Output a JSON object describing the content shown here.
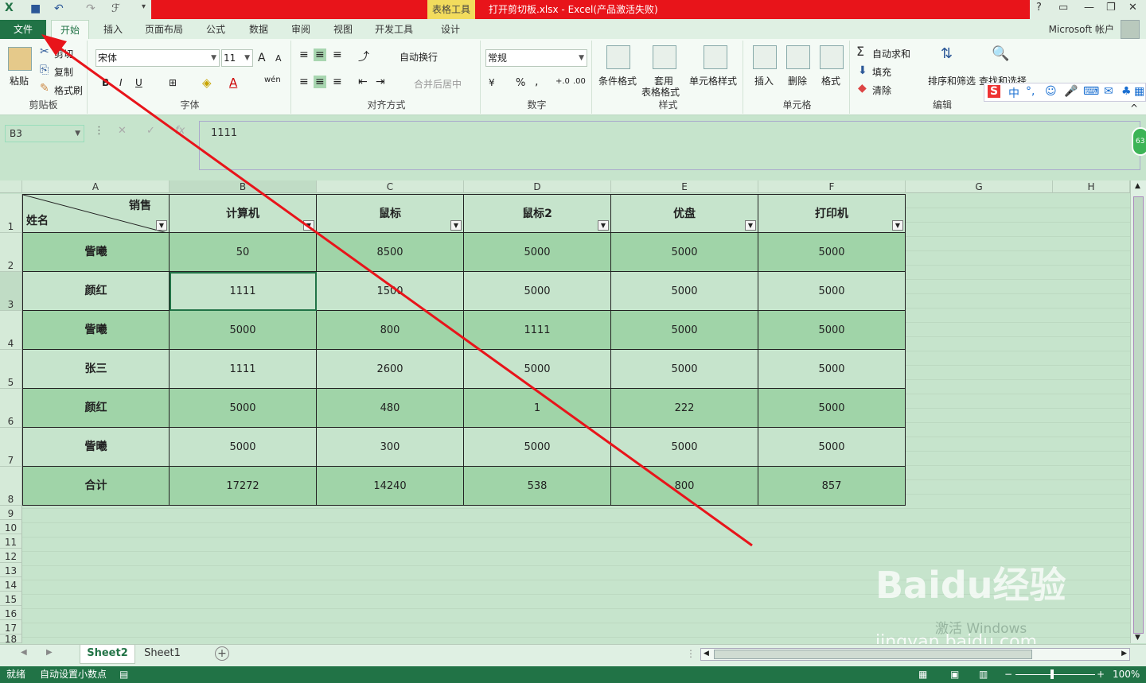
{
  "titlebar": {
    "context_tab": "表格工具",
    "title": "打开剪切板.xlsx -  Excel(产品激活失败)"
  },
  "tabs": [
    "文件",
    "开始",
    "插入",
    "页面布局",
    "公式",
    "数据",
    "审阅",
    "视图",
    "开发工具",
    "设计"
  ],
  "account": "Microsoft 帐户",
  "ribbon": {
    "clipboard": {
      "label": "剪贴板",
      "paste": "粘贴",
      "cut": "剪切",
      "copy": "复制",
      "format_painter": "格式刷"
    },
    "font": {
      "label": "字体",
      "name": "宋体",
      "size": "11"
    },
    "alignment": {
      "label": "对齐方式",
      "wrap": "自动换行",
      "merge": "合并后居中"
    },
    "number": {
      "label": "数字",
      "format": "常规",
      "percent": "%",
      "comma": ","
    },
    "styles": {
      "label": "样式",
      "conditional": "条件格式",
      "table_format_1": "套用",
      "table_format_2": "表格格式",
      "cell_styles": "单元格样式"
    },
    "cells": {
      "label": "单元格",
      "insert": "插入",
      "delete": "删除",
      "format": "格式"
    },
    "editing": {
      "label": "编辑",
      "autosum": "自动求和",
      "fill": "填充",
      "clear": "清除",
      "sort": "排序和筛选",
      "find": "查找和选择"
    }
  },
  "formula": {
    "namebox": "B3",
    "fx": "fx",
    "value": "1111"
  },
  "columns": [
    "A",
    "B",
    "C",
    "D",
    "E",
    "F",
    "G",
    "H"
  ],
  "rows": [
    "1",
    "2",
    "3",
    "4",
    "5",
    "6",
    "7",
    "8",
    "9",
    "10",
    "11",
    "12",
    "13",
    "14",
    "15",
    "16",
    "17",
    "18"
  ],
  "table": {
    "header_corner_top": "销售",
    "header_corner_bottom": "姓名",
    "headers": [
      "计算机",
      "鼠标",
      "鼠标2",
      "优盘",
      "打印机"
    ],
    "data": [
      {
        "name": "訾曦",
        "values": [
          "50",
          "8500",
          "5000",
          "5000",
          "5000"
        ]
      },
      {
        "name": "颜红",
        "values": [
          "1111",
          "1500",
          "5000",
          "5000",
          "5000"
        ]
      },
      {
        "name": "訾曦",
        "values": [
          "5000",
          "800",
          "1111",
          "5000",
          "5000"
        ]
      },
      {
        "name": "张三",
        "values": [
          "1111",
          "2600",
          "5000",
          "5000",
          "5000"
        ]
      },
      {
        "name": "颜红",
        "values": [
          "5000",
          "480",
          "1",
          "222",
          "5000"
        ]
      },
      {
        "name": "訾曦",
        "values": [
          "5000",
          "300",
          "5000",
          "5000",
          "5000"
        ]
      },
      {
        "name": "合计",
        "values": [
          "17272",
          "14240",
          "538",
          "800",
          "857"
        ]
      }
    ]
  },
  "sheets": [
    "Sheet2",
    "Sheet1"
  ],
  "status": {
    "ready": "就绪",
    "autodecimal": "自动设置小数点",
    "zoom": "100%"
  },
  "watermark": {
    "logo": "Baidu经验",
    "url": "jingyan.baidu.com",
    "activate": "激活 Windows"
  },
  "ime": {
    "lang": "中"
  },
  "colors": {
    "excel_green": "#217346",
    "row_dark": "#a0d4a8",
    "row_light": "#c6e4cc",
    "arrow": "#e8141a"
  }
}
